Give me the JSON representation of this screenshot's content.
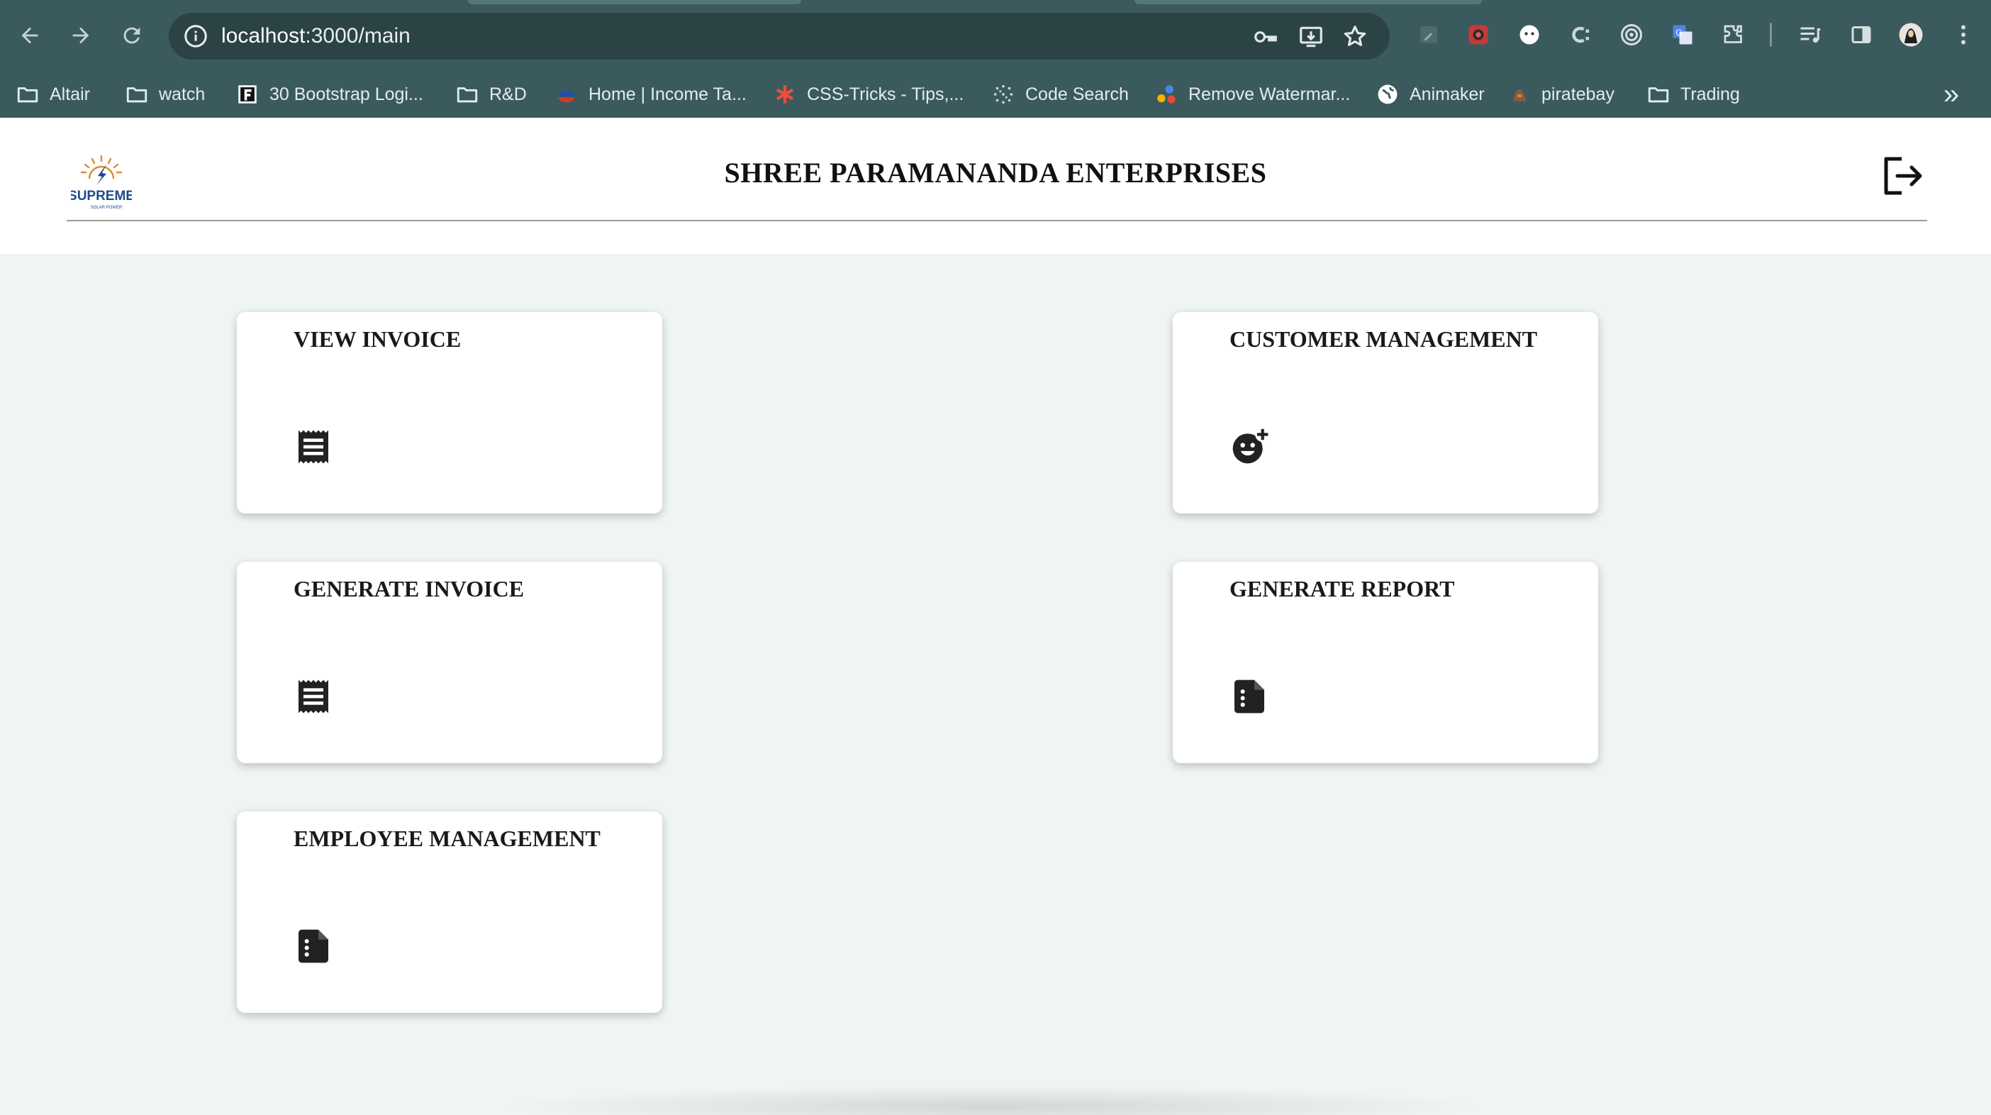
{
  "browser": {
    "url_host": "localhost",
    "url_path": ":3000/main",
    "bookmarks": [
      {
        "label": "Altair",
        "icon": "folder-icon"
      },
      {
        "label": "watch",
        "icon": "folder-icon"
      },
      {
        "label": "30 Bootstrap Logi...",
        "icon": "f-badge-icon"
      },
      {
        "label": "R&D",
        "icon": "folder-icon"
      },
      {
        "label": "Home | Income Ta...",
        "icon": "income-tax-icon"
      },
      {
        "label": "CSS-Tricks - Tips,...",
        "icon": "asterisk-icon"
      },
      {
        "label": "Code Search",
        "icon": "code-search-icon"
      },
      {
        "label": "Remove Watermar...",
        "icon": "dots-icon"
      },
      {
        "label": "Animaker",
        "icon": "globe-icon"
      },
      {
        "label": "piratebay",
        "icon": "pirate-icon"
      },
      {
        "label": "Trading",
        "icon": "folder-icon"
      }
    ],
    "overflow_label": "»"
  },
  "header": {
    "title": "SHREE PARAMANANDA ENTERPRISES",
    "logo": {
      "main": "SUPREME",
      "sub": "SOLAR POWER"
    },
    "logout_icon": "logout-icon"
  },
  "cards": [
    {
      "title": "VIEW INVOICE",
      "icon": "receipt-icon"
    },
    {
      "title": "CUSTOMER MANAGEMENT",
      "icon": "add-reaction-icon"
    },
    {
      "title": "GENERATE INVOICE",
      "icon": "receipt-icon"
    },
    {
      "title": "GENERATE REPORT",
      "icon": "summarize-icon"
    },
    {
      "title": "EMPLOYEE MANAGEMENT",
      "icon": "summarize-icon"
    }
  ],
  "colors": {
    "chrome": "#3b5a5e",
    "omnibox": "#2c4346",
    "page_bg": "#eff4f4",
    "card_bg": "#ffffff"
  }
}
